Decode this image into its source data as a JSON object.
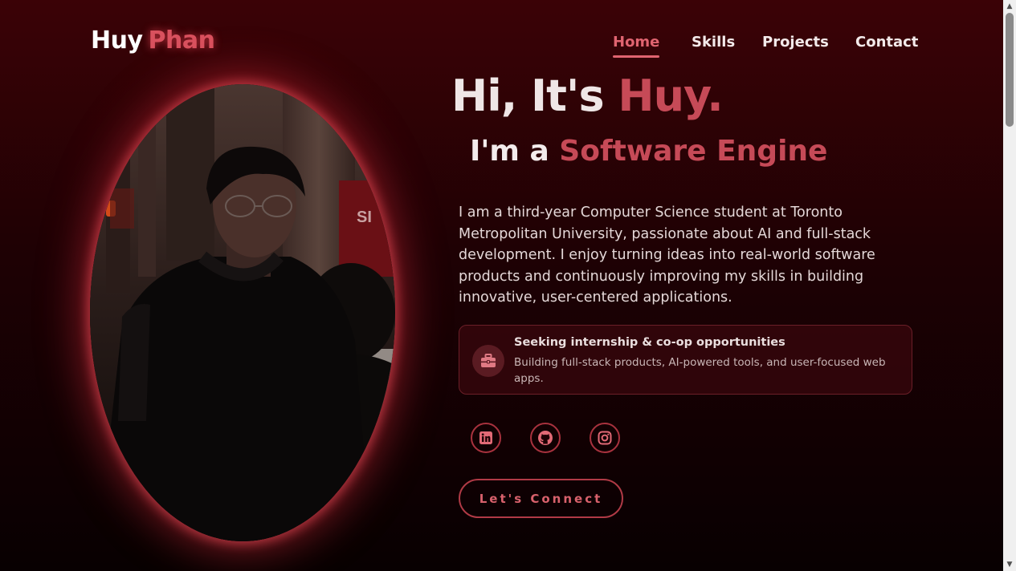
{
  "header": {
    "logo_first": "Huy",
    "logo_last": "Phan"
  },
  "nav": {
    "items": [
      {
        "label": "Home",
        "active": true
      },
      {
        "label": "Skills",
        "active": false
      },
      {
        "label": "Projects",
        "active": false
      },
      {
        "label": "Contact",
        "active": false
      }
    ]
  },
  "hero": {
    "greeting_prefix": "Hi, It's ",
    "greeting_name": "Huy.",
    "role_prefix": "I'm a ",
    "role_typed": "Software Engine",
    "description": "I am a third-year Computer Science student at Toronto Metropolitan University, passionate about AI and full-stack development. I enjoy turning ideas into real-world software products and continuously improving my skills in building innovative, user-centered applications."
  },
  "info_card": {
    "icon": "briefcase-icon",
    "title": "Seeking internship & co-op opportunities",
    "text": "Building full-stack products, AI-powered tools, and user-focused web apps."
  },
  "social": [
    {
      "icon": "linkedin-icon"
    },
    {
      "icon": "github-icon"
    },
    {
      "icon": "instagram-icon"
    }
  ],
  "cta": {
    "label": "Let's Connect"
  },
  "colors": {
    "accent": "#c64a57",
    "accent_bright": "#e06470",
    "background_top": "#3b0206",
    "background_bottom": "#080001"
  }
}
